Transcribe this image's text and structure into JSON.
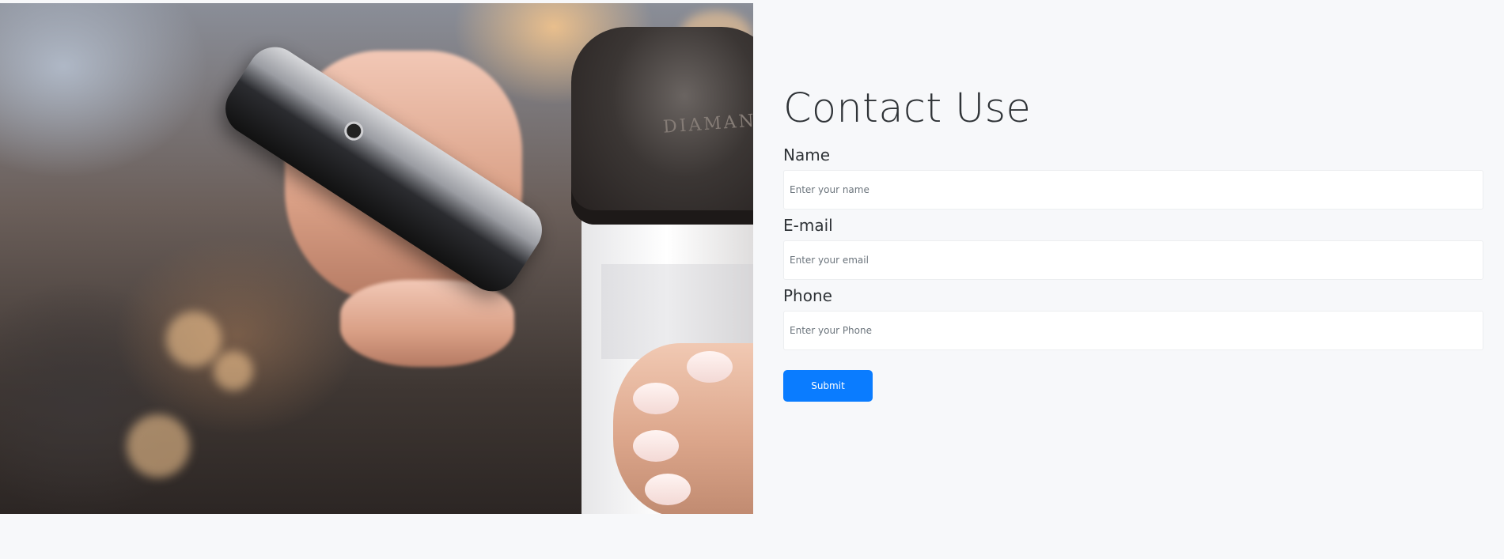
{
  "hero": {
    "image_description_icon": "photo-hand-phone-coffee-cup",
    "cup_lid_text": "DIAMANT"
  },
  "contact": {
    "title": "Contact Use",
    "fields": [
      {
        "label": "Name",
        "placeholder": "Enter your name",
        "value": ""
      },
      {
        "label": "E-mail",
        "placeholder": "Enter your email",
        "value": ""
      },
      {
        "label": "Phone",
        "placeholder": "Enter your Phone",
        "value": ""
      }
    ],
    "submit_label": "Submit"
  },
  "colors": {
    "page_background": "#f7f8fa",
    "accent": "#0a7cff",
    "text": "#2f3337"
  }
}
